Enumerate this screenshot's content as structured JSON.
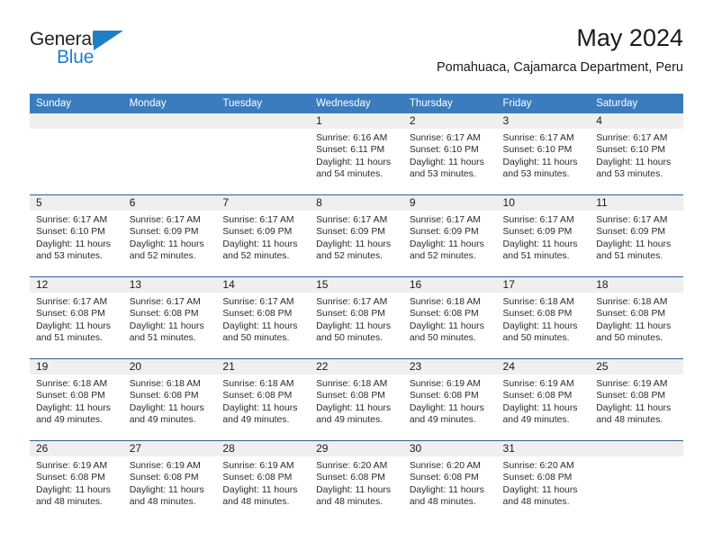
{
  "logo": {
    "line1": "General",
    "line2": "Blue",
    "triangle_color": "#1f7fc6",
    "text_color": "#231f20"
  },
  "header": {
    "title": "May 2024",
    "subtitle": "Pomahuaca, Cajamarca Department, Peru"
  },
  "theme": {
    "header_blue": "#3b7cbe",
    "row_rule": "#2f5f92",
    "daynum_band": "#efefef"
  },
  "weekdays": [
    "Sunday",
    "Monday",
    "Tuesday",
    "Wednesday",
    "Thursday",
    "Friday",
    "Saturday"
  ],
  "weeks": [
    [
      {
        "day": "",
        "lines": []
      },
      {
        "day": "",
        "lines": []
      },
      {
        "day": "",
        "lines": []
      },
      {
        "day": "1",
        "lines": [
          "Sunrise: 6:16 AM",
          "Sunset: 6:11 PM",
          "Daylight: 11 hours",
          "and 54 minutes."
        ]
      },
      {
        "day": "2",
        "lines": [
          "Sunrise: 6:17 AM",
          "Sunset: 6:10 PM",
          "Daylight: 11 hours",
          "and 53 minutes."
        ]
      },
      {
        "day": "3",
        "lines": [
          "Sunrise: 6:17 AM",
          "Sunset: 6:10 PM",
          "Daylight: 11 hours",
          "and 53 minutes."
        ]
      },
      {
        "day": "4",
        "lines": [
          "Sunrise: 6:17 AM",
          "Sunset: 6:10 PM",
          "Daylight: 11 hours",
          "and 53 minutes."
        ]
      }
    ],
    [
      {
        "day": "5",
        "lines": [
          "Sunrise: 6:17 AM",
          "Sunset: 6:10 PM",
          "Daylight: 11 hours",
          "and 53 minutes."
        ]
      },
      {
        "day": "6",
        "lines": [
          "Sunrise: 6:17 AM",
          "Sunset: 6:09 PM",
          "Daylight: 11 hours",
          "and 52 minutes."
        ]
      },
      {
        "day": "7",
        "lines": [
          "Sunrise: 6:17 AM",
          "Sunset: 6:09 PM",
          "Daylight: 11 hours",
          "and 52 minutes."
        ]
      },
      {
        "day": "8",
        "lines": [
          "Sunrise: 6:17 AM",
          "Sunset: 6:09 PM",
          "Daylight: 11 hours",
          "and 52 minutes."
        ]
      },
      {
        "day": "9",
        "lines": [
          "Sunrise: 6:17 AM",
          "Sunset: 6:09 PM",
          "Daylight: 11 hours",
          "and 52 minutes."
        ]
      },
      {
        "day": "10",
        "lines": [
          "Sunrise: 6:17 AM",
          "Sunset: 6:09 PM",
          "Daylight: 11 hours",
          "and 51 minutes."
        ]
      },
      {
        "day": "11",
        "lines": [
          "Sunrise: 6:17 AM",
          "Sunset: 6:09 PM",
          "Daylight: 11 hours",
          "and 51 minutes."
        ]
      }
    ],
    [
      {
        "day": "12",
        "lines": [
          "Sunrise: 6:17 AM",
          "Sunset: 6:08 PM",
          "Daylight: 11 hours",
          "and 51 minutes."
        ]
      },
      {
        "day": "13",
        "lines": [
          "Sunrise: 6:17 AM",
          "Sunset: 6:08 PM",
          "Daylight: 11 hours",
          "and 51 minutes."
        ]
      },
      {
        "day": "14",
        "lines": [
          "Sunrise: 6:17 AM",
          "Sunset: 6:08 PM",
          "Daylight: 11 hours",
          "and 50 minutes."
        ]
      },
      {
        "day": "15",
        "lines": [
          "Sunrise: 6:17 AM",
          "Sunset: 6:08 PM",
          "Daylight: 11 hours",
          "and 50 minutes."
        ]
      },
      {
        "day": "16",
        "lines": [
          "Sunrise: 6:18 AM",
          "Sunset: 6:08 PM",
          "Daylight: 11 hours",
          "and 50 minutes."
        ]
      },
      {
        "day": "17",
        "lines": [
          "Sunrise: 6:18 AM",
          "Sunset: 6:08 PM",
          "Daylight: 11 hours",
          "and 50 minutes."
        ]
      },
      {
        "day": "18",
        "lines": [
          "Sunrise: 6:18 AM",
          "Sunset: 6:08 PM",
          "Daylight: 11 hours",
          "and 50 minutes."
        ]
      }
    ],
    [
      {
        "day": "19",
        "lines": [
          "Sunrise: 6:18 AM",
          "Sunset: 6:08 PM",
          "Daylight: 11 hours",
          "and 49 minutes."
        ]
      },
      {
        "day": "20",
        "lines": [
          "Sunrise: 6:18 AM",
          "Sunset: 6:08 PM",
          "Daylight: 11 hours",
          "and 49 minutes."
        ]
      },
      {
        "day": "21",
        "lines": [
          "Sunrise: 6:18 AM",
          "Sunset: 6:08 PM",
          "Daylight: 11 hours",
          "and 49 minutes."
        ]
      },
      {
        "day": "22",
        "lines": [
          "Sunrise: 6:18 AM",
          "Sunset: 6:08 PM",
          "Daylight: 11 hours",
          "and 49 minutes."
        ]
      },
      {
        "day": "23",
        "lines": [
          "Sunrise: 6:19 AM",
          "Sunset: 6:08 PM",
          "Daylight: 11 hours",
          "and 49 minutes."
        ]
      },
      {
        "day": "24",
        "lines": [
          "Sunrise: 6:19 AM",
          "Sunset: 6:08 PM",
          "Daylight: 11 hours",
          "and 49 minutes."
        ]
      },
      {
        "day": "25",
        "lines": [
          "Sunrise: 6:19 AM",
          "Sunset: 6:08 PM",
          "Daylight: 11 hours",
          "and 48 minutes."
        ]
      }
    ],
    [
      {
        "day": "26",
        "lines": [
          "Sunrise: 6:19 AM",
          "Sunset: 6:08 PM",
          "Daylight: 11 hours",
          "and 48 minutes."
        ]
      },
      {
        "day": "27",
        "lines": [
          "Sunrise: 6:19 AM",
          "Sunset: 6:08 PM",
          "Daylight: 11 hours",
          "and 48 minutes."
        ]
      },
      {
        "day": "28",
        "lines": [
          "Sunrise: 6:19 AM",
          "Sunset: 6:08 PM",
          "Daylight: 11 hours",
          "and 48 minutes."
        ]
      },
      {
        "day": "29",
        "lines": [
          "Sunrise: 6:20 AM",
          "Sunset: 6:08 PM",
          "Daylight: 11 hours",
          "and 48 minutes."
        ]
      },
      {
        "day": "30",
        "lines": [
          "Sunrise: 6:20 AM",
          "Sunset: 6:08 PM",
          "Daylight: 11 hours",
          "and 48 minutes."
        ]
      },
      {
        "day": "31",
        "lines": [
          "Sunrise: 6:20 AM",
          "Sunset: 6:08 PM",
          "Daylight: 11 hours",
          "and 48 minutes."
        ]
      },
      {
        "day": "",
        "lines": []
      }
    ]
  ]
}
